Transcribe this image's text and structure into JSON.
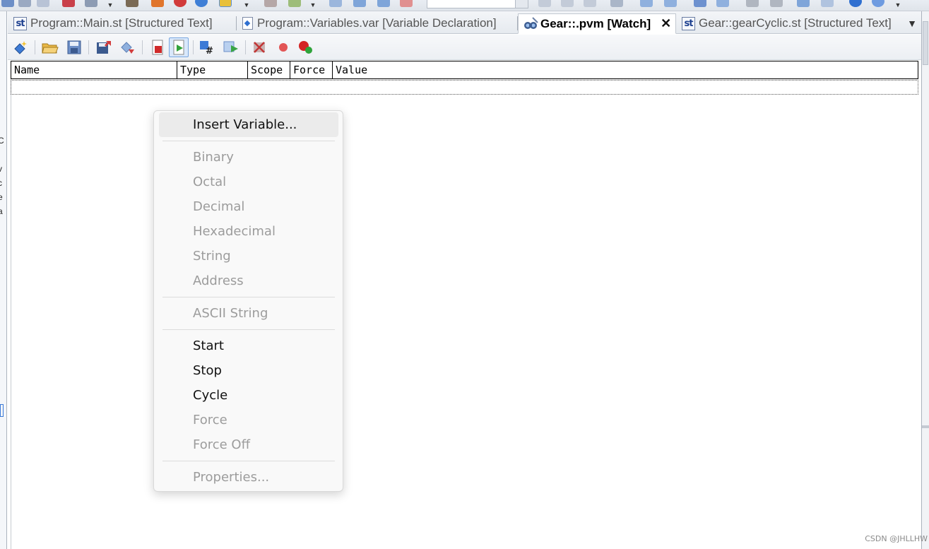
{
  "tabs": [
    {
      "label": "Program::Main.st [Structured Text]",
      "icon": "st-file-icon",
      "active": false
    },
    {
      "label": "Program::Variables.var [Variable Declaration]",
      "icon": "variable-file-icon",
      "active": false
    },
    {
      "label": "Gear::.pvm [Watch]",
      "icon": "watch-icon",
      "active": true
    },
    {
      "label": "Gear::gearCyclic.st [Structured Text]",
      "icon": "st-file-icon",
      "active": false
    }
  ],
  "tab_icon_text": "st",
  "tab_close_glyph": "✕",
  "tab_overflow_glyph": "▼",
  "grid": {
    "columns": [
      "Name",
      "Type",
      "Scope",
      "Force",
      "Value"
    ]
  },
  "context_menu": {
    "groups": [
      [
        {
          "label": "Insert Variable...",
          "enabled": true,
          "highlighted": true
        }
      ],
      [
        {
          "label": "Binary",
          "enabled": false
        },
        {
          "label": "Octal",
          "enabled": false
        },
        {
          "label": "Decimal",
          "enabled": false
        },
        {
          "label": "Hexadecimal",
          "enabled": false
        },
        {
          "label": "String",
          "enabled": false
        },
        {
          "label": "Address",
          "enabled": false
        }
      ],
      [
        {
          "label": "ASCII String",
          "enabled": false
        }
      ],
      [
        {
          "label": "Start",
          "enabled": true
        },
        {
          "label": "Stop",
          "enabled": true
        },
        {
          "label": "Cycle",
          "enabled": true
        },
        {
          "label": "Force",
          "enabled": false
        },
        {
          "label": "Force Off",
          "enabled": false
        }
      ],
      [
        {
          "label": "Properties...",
          "enabled": false
        }
      ]
    ]
  },
  "left_fragments": [
    "C",
    "v",
    "c",
    "e",
    "a"
  ],
  "watermark": "CSDN @JHLLHW",
  "colors": {
    "accent": "#2f6fd0",
    "disabled_text": "#9c9c9c",
    "highlight": "#ebebeb"
  }
}
